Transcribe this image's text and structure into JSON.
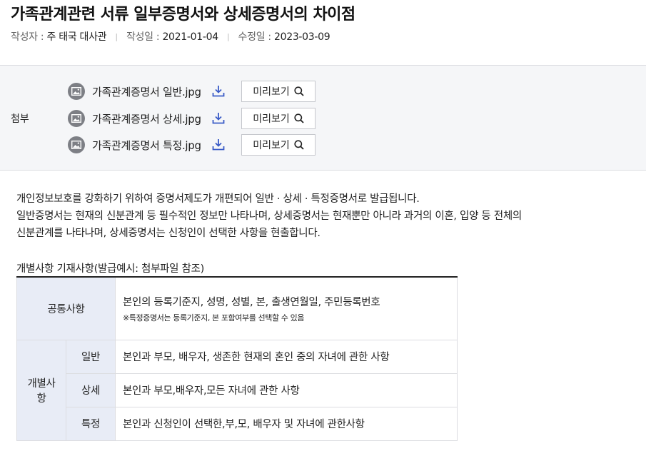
{
  "header": {
    "title": "가족관계관련 서류 일부증명서와 상세증명서의 차이점",
    "author_label": "작성자 :",
    "author": "주 태국 대사관",
    "created_label": "작성일 :",
    "created": "2021-01-04",
    "modified_label": "수정일 :",
    "modified": "2023-03-09",
    "separator": "|"
  },
  "attachments": {
    "label": "첨부",
    "preview_label": "미리보기",
    "files": [
      {
        "name": "가족관계증명서 일반.jpg",
        "icon": "image-icon"
      },
      {
        "name": "가족관계증명서 상세.jpg",
        "icon": "image-icon"
      },
      {
        "name": "가족관계증명서 특정.jpg",
        "icon": "image-icon"
      }
    ]
  },
  "body": {
    "lines": [
      "개인정보보호를 강화하기 위하여 증명서제도가 개편되어 일반 · 상세 · 특정증명서로 발급됩니다.",
      "일반증명서는 현재의 신분관계 등 필수적인 정보만 나타나며, 상세증명서는 현재뿐만 아니라 과거의 이혼, 입양 등 전체의",
      "신분관계를 나타나며, 상세증명서는 신청인이 선택한 사항을 현출합니다."
    ]
  },
  "table": {
    "caption": "개별사항 기재사항(발급예시: 첨부파일 참조)",
    "common_header": "공통사항",
    "common_value": "본인의 등록기준지, 성명, 성별, 본, 출생연월일, 주민등록번호",
    "common_note": "※특정증명서는 등록기준지, 본 포함여부를 선택할 수 있음",
    "individual_header": "개별사항",
    "rows": [
      {
        "type": "일반",
        "value": "본인과 부모, 배우자, 생존한 현재의 혼인 중의 자녀에 관한 사항"
      },
      {
        "type": "상세",
        "value": "본인과 부모,배우자,모든 자녀에 관한 사항"
      },
      {
        "type": "특정",
        "value": "본인과 신청인이 선택한,부,모, 배우자 및 자녀에 관한사항"
      }
    ]
  },
  "colors": {
    "table_header_bg": "#e8ecf6",
    "attach_bg": "#f5f6f8",
    "download_icon": "#3a5bc7"
  }
}
